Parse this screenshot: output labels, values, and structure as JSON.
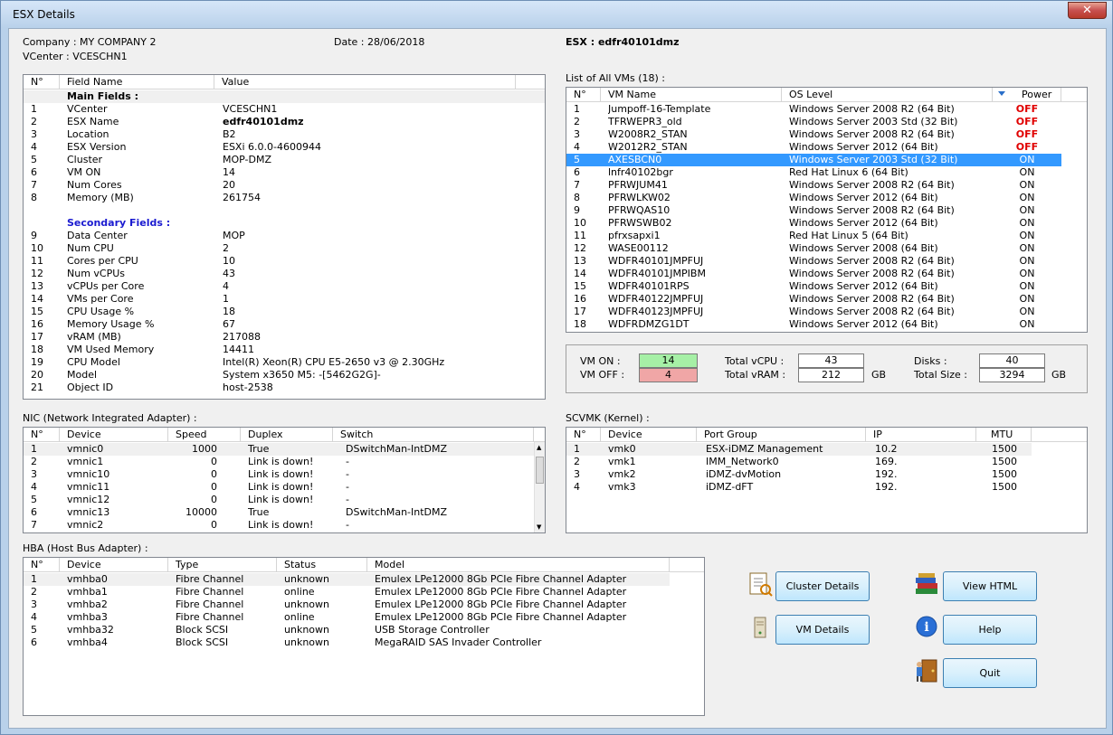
{
  "window": {
    "title": "ESX Details",
    "close_label": "✕"
  },
  "header": {
    "company": "Company : MY COMPANY 2",
    "vcenter": "VCenter : VCESCHN1",
    "date": "Date : 28/06/2018",
    "esx": "ESX : edfr40101dmz"
  },
  "fields_grid": {
    "columns": [
      "N°",
      "Field Name",
      "Value"
    ],
    "main_title": "Main Fields :",
    "secondary_title": "Secondary Fields :",
    "main_rows": [
      [
        "1",
        "VCenter",
        "VCESCHN1"
      ],
      [
        "2",
        "ESX Name",
        "edfr40101dmz"
      ],
      [
        "3",
        "Location",
        "B2"
      ],
      [
        "4",
        "ESX Version",
        "ESXi 6.0.0-4600944"
      ],
      [
        "5",
        "Cluster",
        "MOP-DMZ"
      ],
      [
        "6",
        "VM ON",
        "14"
      ],
      [
        "7",
        "Num Cores",
        "20"
      ],
      [
        "8",
        "Memory (MB)",
        "261754"
      ]
    ],
    "secondary_rows": [
      [
        "9",
        "Data Center",
        "MOP"
      ],
      [
        "10",
        "Num CPU",
        "2"
      ],
      [
        "11",
        "Cores per CPU",
        "10"
      ],
      [
        "12",
        "Num vCPUs",
        "43"
      ],
      [
        "13",
        "vCPUs per Core",
        "4"
      ],
      [
        "14",
        "VMs per Core",
        "1"
      ],
      [
        "15",
        "CPU Usage %",
        "18"
      ],
      [
        "16",
        "Memory Usage %",
        "67"
      ],
      [
        "17",
        "vRAM (MB)",
        "217088"
      ],
      [
        "18",
        "VM Used Memory",
        "14411"
      ],
      [
        "19",
        "CPU Model",
        "Intel(R) Xeon(R) CPU E5-2650 v3 @ 2.30GHz"
      ],
      [
        "20",
        "Model",
        "System x3650 M5: -[5462G2G]-"
      ],
      [
        "21",
        "Object ID",
        "host-2538"
      ]
    ]
  },
  "vm_list": {
    "title": "List of All VMs (18) :",
    "columns": [
      "N°",
      "VM Name",
      "OS Level",
      "Power"
    ],
    "rows": [
      [
        "1",
        "Jumpoff-16-Template",
        "Windows Server 2008 R2 (64 Bit)",
        "OFF"
      ],
      [
        "2",
        "TFRWEPR3_old",
        "Windows Server 2003 Std (32 Bit)",
        "OFF"
      ],
      [
        "3",
        "W2008R2_STAN",
        "Windows Server 2008 R2 (64 Bit)",
        "OFF"
      ],
      [
        "4",
        "W2012R2_STAN",
        "Windows Server 2012 (64 Bit)",
        "OFF"
      ],
      [
        "5",
        "AXESBCN0",
        "Windows Server 2003 Std (32 Bit)",
        "ON"
      ],
      [
        "6",
        "lnfr40102bgr",
        "Red Hat Linux 6 (64 Bit)",
        "ON"
      ],
      [
        "7",
        "PFRWJUM41",
        "Windows Server 2008 R2 (64 Bit)",
        "ON"
      ],
      [
        "8",
        "PFRWLKW02",
        "Windows Server 2012 (64 Bit)",
        "ON"
      ],
      [
        "9",
        "PFRWQAS10",
        "Windows Server 2008 R2 (64 Bit)",
        "ON"
      ],
      [
        "10",
        "PFRWSWB02",
        "Windows Server 2012 (64 Bit)",
        "ON"
      ],
      [
        "11",
        "pfrxsapxi1",
        "Red Hat Linux 5 (64 Bit)",
        "ON"
      ],
      [
        "12",
        "WASE00112",
        "Windows Server 2008 (64 Bit)",
        "ON"
      ],
      [
        "13",
        "WDFR40101JMPFUJ",
        "Windows Server 2008 R2 (64 Bit)",
        "ON"
      ],
      [
        "14",
        "WDFR40101JMPIBM",
        "Windows Server 2008 R2 (64 Bit)",
        "ON"
      ],
      [
        "15",
        "WDFR40101RPS",
        "Windows Server 2012 (64 Bit)",
        "ON"
      ],
      [
        "16",
        "WDFR40122JMPFUJ",
        "Windows Server 2008 R2 (64 Bit)",
        "ON"
      ],
      [
        "17",
        "WDFR40123JMPFUJ",
        "Windows Server 2008 R2 (64 Bit)",
        "ON"
      ],
      [
        "18",
        "WDFRDMZG1DT",
        "Windows Server 2012 (64 Bit)",
        "ON"
      ]
    ],
    "selected_index": 4
  },
  "summary": {
    "vm_on_label": "VM ON :",
    "vm_on": "14",
    "vm_off_label": "VM OFF :",
    "vm_off": "4",
    "total_vcpu_label": "Total vCPU :",
    "total_vcpu": "43",
    "total_vram_label": "Total vRAM :",
    "total_vram": "212",
    "vram_unit": "GB",
    "disks_label": "Disks :",
    "disks": "40",
    "total_size_label": "Total Size :",
    "total_size": "3294",
    "size_unit": "GB",
    "on_color": "#a6f0a6",
    "off_color": "#f0a6a6"
  },
  "nic": {
    "title": "NIC (Network Integrated Adapter) :",
    "columns": [
      "N°",
      "Device",
      "Speed",
      "Duplex",
      "Switch"
    ],
    "rows": [
      [
        "1",
        "vmnic0",
        "1000",
        "True",
        "DSwitchMan-IntDMZ"
      ],
      [
        "2",
        "vmnic1",
        "0",
        "Link is down!",
        "-"
      ],
      [
        "3",
        "vmnic10",
        "0",
        "Link is down!",
        "-"
      ],
      [
        "4",
        "vmnic11",
        "0",
        "Link is down!",
        "-"
      ],
      [
        "5",
        "vmnic12",
        "0",
        "Link is down!",
        "-"
      ],
      [
        "6",
        "vmnic13",
        "10000",
        "True",
        "DSwitchMan-IntDMZ"
      ],
      [
        "7",
        "vmnic2",
        "0",
        "Link is down!",
        "-"
      ]
    ]
  },
  "scvmk": {
    "title": "SCVMK (Kernel) :",
    "columns": [
      "N°",
      "Device",
      "Port Group",
      "IP",
      "MTU"
    ],
    "rows": [
      [
        "1",
        "vmk0",
        "ESX-iDMZ Management",
        "10.2",
        "1500"
      ],
      [
        "2",
        "vmk1",
        "IMM_Network0",
        "169.",
        "1500"
      ],
      [
        "3",
        "vmk2",
        "iDMZ-dvMotion",
        "192.",
        "1500"
      ],
      [
        "4",
        "vmk3",
        "iDMZ-dFT",
        "192.",
        "1500"
      ]
    ]
  },
  "hba": {
    "title": "HBA (Host Bus Adapter) :",
    "columns": [
      "N°",
      "Device",
      "Type",
      "Status",
      "Model"
    ],
    "rows": [
      [
        "1",
        "vmhba0",
        "Fibre Channel",
        "unknown",
        "Emulex LPe12000 8Gb PCIe Fibre Channel Adapter"
      ],
      [
        "2",
        "vmhba1",
        "Fibre Channel",
        "online",
        "Emulex LPe12000 8Gb PCIe Fibre Channel Adapter"
      ],
      [
        "3",
        "vmhba2",
        "Fibre Channel",
        "unknown",
        "Emulex LPe12000 8Gb PCIe Fibre Channel Adapter"
      ],
      [
        "4",
        "vmhba3",
        "Fibre Channel",
        "online",
        "Emulex LPe12000 8Gb PCIe Fibre Channel Adapter"
      ],
      [
        "5",
        "vmhba32",
        "Block SCSI",
        "unknown",
        "USB Storage Controller"
      ],
      [
        "6",
        "vmhba4",
        "Block SCSI",
        "unknown",
        "MegaRAID SAS Invader Controller"
      ]
    ]
  },
  "buttons": {
    "cluster_details": "Cluster Details",
    "vm_details": "VM Details",
    "view_html": "View HTML",
    "help": "Help",
    "quit": "Quit"
  },
  "icons": [
    "report-icon",
    "server-icon",
    "books-icon",
    "info-icon",
    "exit-door-icon",
    "sort-arrow-icon"
  ]
}
